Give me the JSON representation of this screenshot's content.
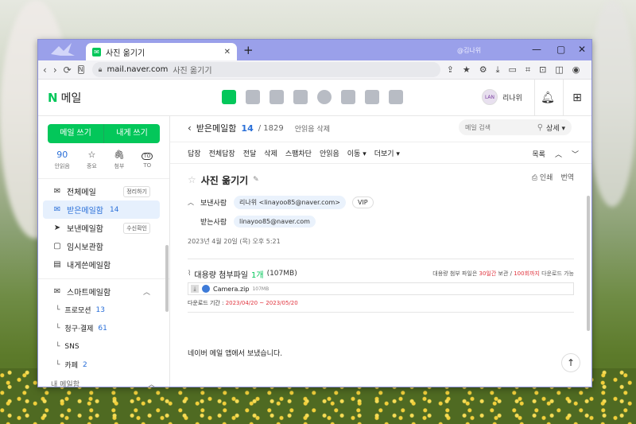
{
  "browser": {
    "tab_title": "사진 옮기기",
    "new_tab": "+",
    "profile_name": "@김나위",
    "url": "mail.naver.com",
    "url_page_title": "사진 옮기기"
  },
  "header": {
    "logo_n": "N",
    "logo_text": "메일",
    "user_avatar_text": "LAN",
    "user_name": "리나위"
  },
  "sidebar": {
    "compose_label": "메일 쓰기",
    "to_me_label": "내게 쓰기",
    "quick": [
      {
        "top": "90",
        "label": "안읽음"
      },
      {
        "top": "☆",
        "label": "중요"
      },
      {
        "top": "🖇",
        "label": "첨부"
      },
      {
        "top": "TO",
        "label": "TO"
      }
    ],
    "items": [
      {
        "icon": "✉",
        "label": "전체메일",
        "count": "",
        "tag": "정리하기"
      },
      {
        "icon": "✉",
        "label": "받은메일함",
        "count": "14",
        "tag": ""
      },
      {
        "icon": "➤",
        "label": "보낸메일함",
        "count": "",
        "tag": "수신확인"
      },
      {
        "icon": "▢",
        "label": "임시보관함",
        "count": "",
        "tag": ""
      },
      {
        "icon": "▤",
        "label": "내게쓴메일함",
        "count": "",
        "tag": ""
      }
    ],
    "smart_label": "스마트메일함",
    "smart_items": [
      {
        "label": "프로모션",
        "count": "13"
      },
      {
        "label": "청구·결제",
        "count": "61"
      },
      {
        "label": "SNS",
        "count": ""
      },
      {
        "label": "카페",
        "count": "2"
      }
    ],
    "my_mail_label": "내 메일함"
  },
  "list": {
    "folder_name": "받은메일함",
    "unread": "14",
    "total": "/ 1829",
    "unread_delete": "안읽음 삭제",
    "search_placeholder": "메일 검색",
    "detail_label": "상세 ▾"
  },
  "toolbar": {
    "buttons": [
      "답장",
      "전체답장",
      "전달",
      "삭제",
      "스팸차단",
      "안읽음",
      "이동 ▾",
      "더보기 ▾"
    ],
    "list_label": "목록",
    "up": "︿",
    "down": "﹀"
  },
  "message": {
    "subject": "사진 옮기기",
    "print_label": "인쇄",
    "translate_label": "번역",
    "sender_label": "보낸사람",
    "sender": "리나위 <linayoo85@naver.com>",
    "vip": "VIP",
    "recipient_label": "받는사람",
    "recipient": "linayoo85@naver.com",
    "date": "2023년 4월 20일 (목) 오후 5:21",
    "attachment": {
      "title": "대용량 첨부파일",
      "count": "1개",
      "size": "(107MB)",
      "note_prefix": "대용량 첨부 파일은 ",
      "note_days": "30일간",
      "note_mid": " 보관 / ",
      "note_times": "100회까지",
      "note_suffix": " 다운로드 가능",
      "file_name": "Camera.zip",
      "file_size": "107MB",
      "period_label": "다운로드 기간 : ",
      "period": "2023/04/20 ~ 2023/05/20"
    },
    "body": "네이버 메일 앱에서 보냈습니다."
  },
  "colors": {
    "brand": "#03c75a",
    "link": "#2a6fd8",
    "titlebar": "#9aa0ea"
  }
}
